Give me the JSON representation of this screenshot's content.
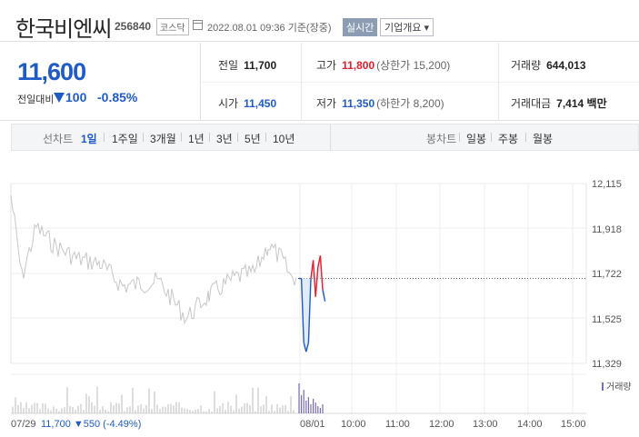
{
  "header": {
    "company_name": "한국비엔씨",
    "code": "256840",
    "market": "코스닥",
    "datetime": "2022.08.01 09:36 기준(장중)",
    "realtime_label": "실시간",
    "company_info_label": "기업개요 ▾"
  },
  "quote": {
    "price": "11,600",
    "change_label": "전일대비",
    "change_value": "100",
    "change_pct": "-0.85%",
    "prev_close_label": "전일",
    "prev_close": "11,700",
    "high_label": "고가",
    "high": "11,800",
    "upper_limit": "(상한가 15,200)",
    "volume_label": "거래량",
    "volume": "644,013",
    "open_label": "시가",
    "open": "11,450",
    "low_label": "저가",
    "low": "11,350",
    "lower_limit": "(하한가 8,200)",
    "amount_label": "거래대금",
    "amount": "7,414 백만"
  },
  "periods": {
    "line_label": "선차트",
    "items": [
      "1일",
      "1주일",
      "3개월",
      "1년",
      "3년",
      "5년",
      "10년"
    ],
    "active": "1일",
    "candle_label": "봉차트",
    "candle_items": [
      "일봉",
      "주봉",
      "월봉"
    ]
  },
  "chart_data": {
    "type": "line",
    "y_ticks": [
      "12,115",
      "11,918",
      "11,722",
      "11,525",
      "11,329"
    ],
    "ylim": [
      11329,
      12115
    ],
    "x_ticks": [
      "08/01",
      "10:00",
      "11:00",
      "12:00",
      "13:00",
      "14:00",
      "15:00"
    ],
    "prev_close_ref": 11700,
    "prev_day_label": "07/29",
    "prev_day_summary": "11,700 ▼550 (-4.49%)",
    "volume_legend": "거래량",
    "today_series": [
      11700,
      11700,
      11420,
      11380,
      11420,
      11700,
      11780,
      11620,
      11750,
      11800,
      11650,
      11600
    ],
    "colors": {
      "down": "#1f5bc6",
      "up": "#e0202b",
      "prev": "#c7c7c7",
      "volume": "#7b6bb2"
    }
  }
}
